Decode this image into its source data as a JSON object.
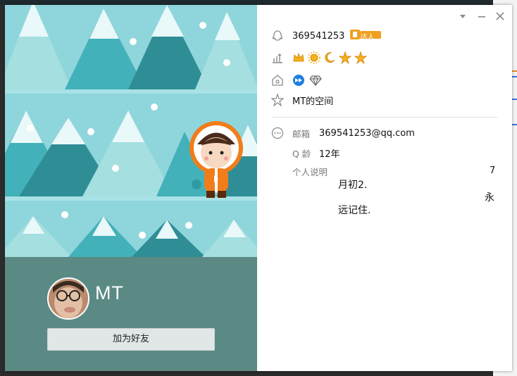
{
  "profile": {
    "qq_number": "369541253",
    "vip_badge": "达人",
    "space_link": "MT的空间",
    "nickname": "MT"
  },
  "details": {
    "email_label": "邮箱",
    "email_value": "369541253@qq.com",
    "qage_label": "Q 龄",
    "qage_value": "12年",
    "signature_label": "个人说明",
    "signature_lines": [
      "7",
      "月初2.",
      "永",
      "远记住."
    ]
  },
  "actions": {
    "add_friend_label": "加为好友"
  },
  "window_controls": [
    "dropdown-icon",
    "minimize-icon",
    "close-icon"
  ],
  "colors": {
    "scene_bg": "#8fd5dc",
    "card_bg": "#5b8a85",
    "button_bg": "#e1e6e7",
    "vip_orange": "#f0a020"
  }
}
